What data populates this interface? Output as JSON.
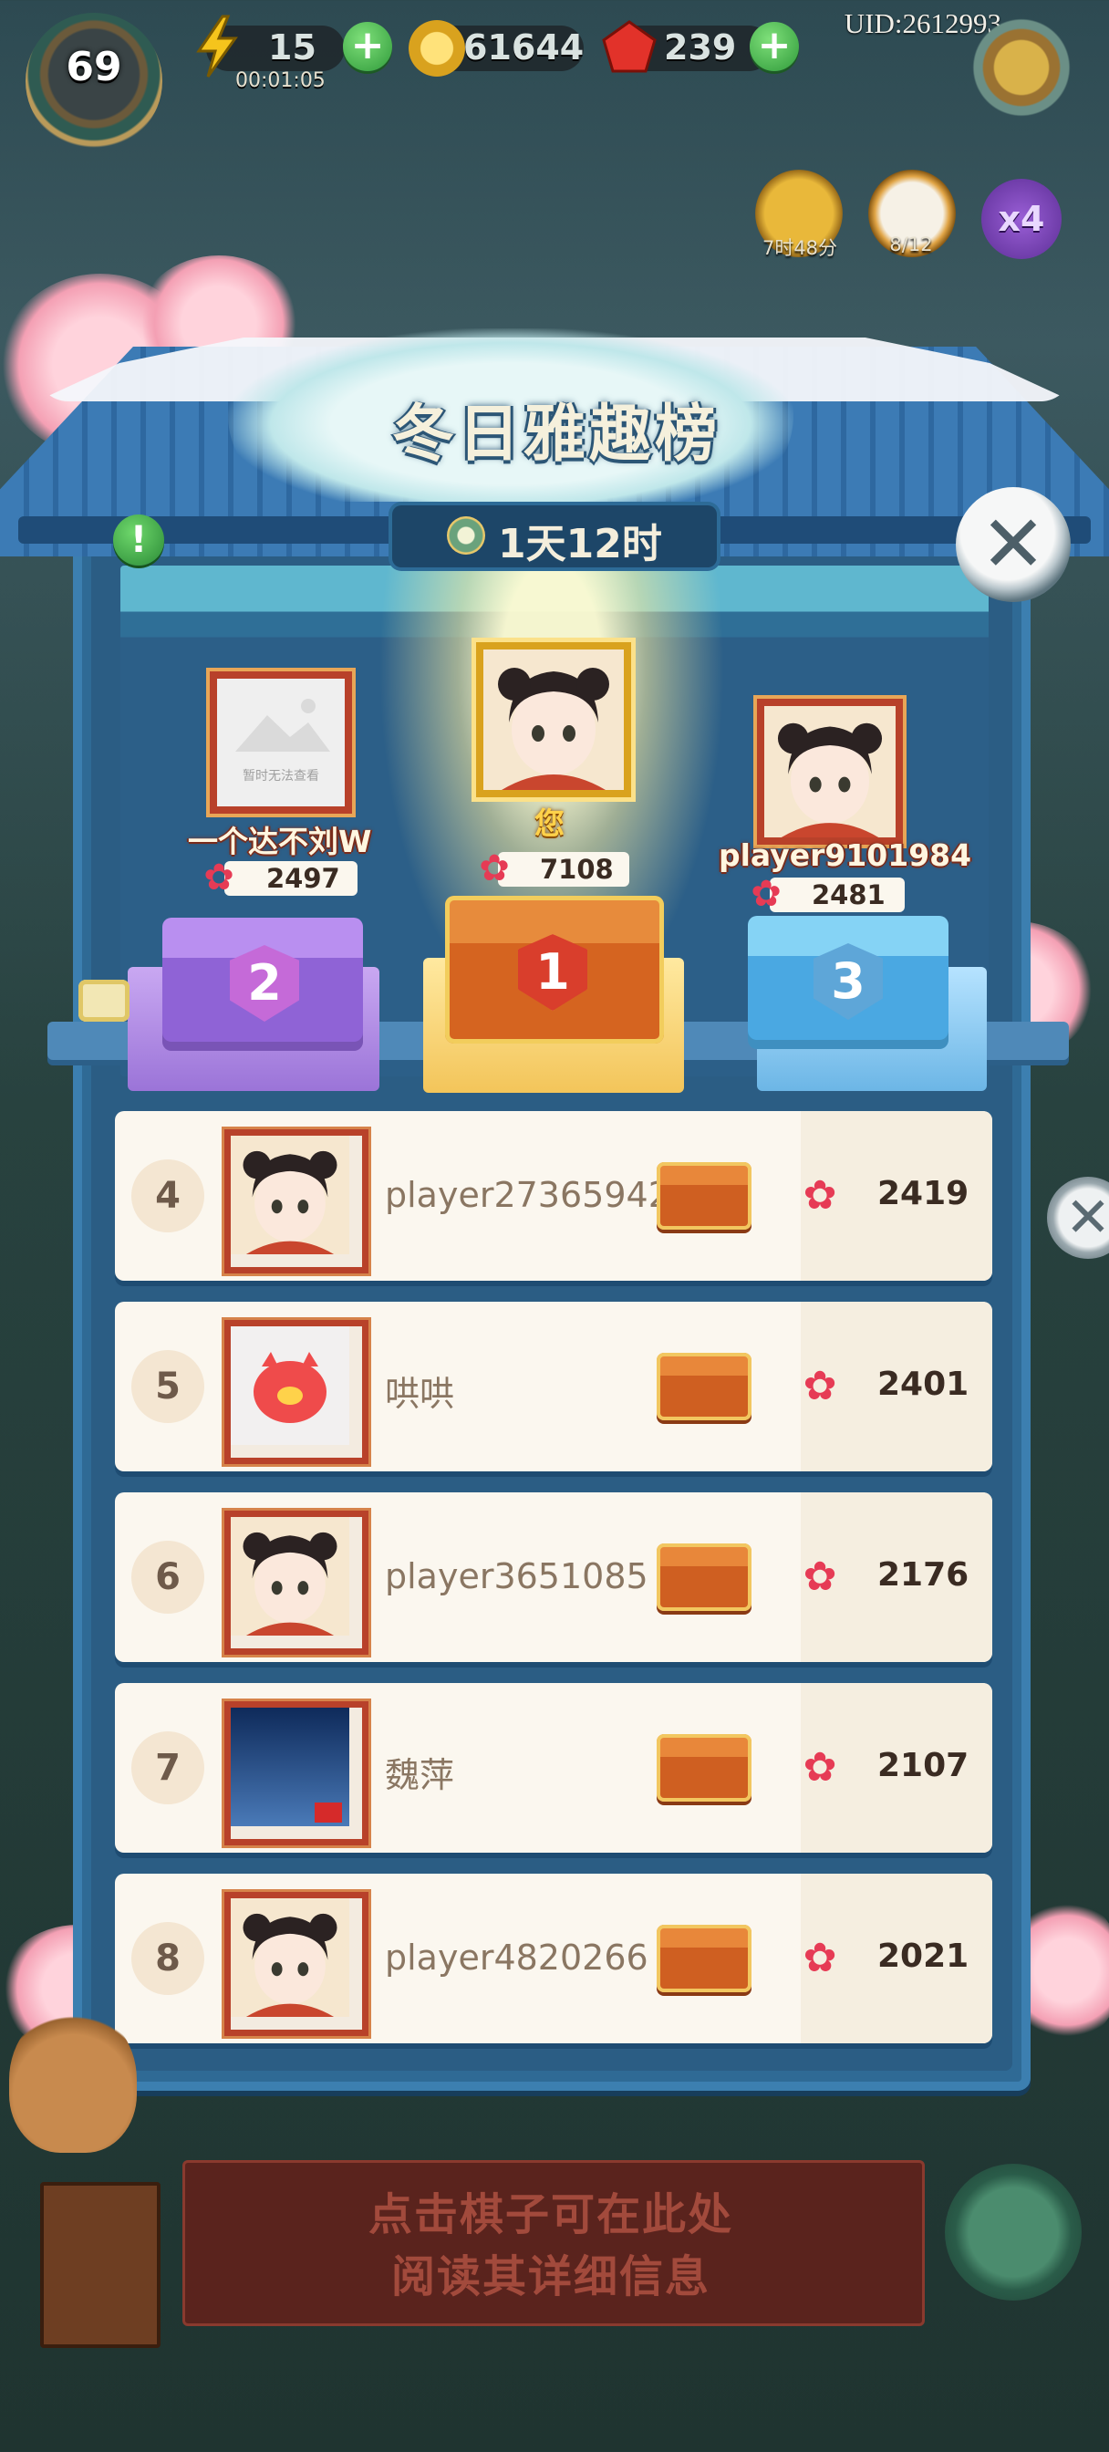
{
  "hud": {
    "level": "69",
    "energy": "15",
    "energy_timer": "00:01:05",
    "coins": "61644",
    "gems": "239",
    "uid": "UID:2612993",
    "side_timer": "7时48分",
    "side_count": "8/12",
    "multiplier": "x4",
    "badge_count": "12"
  },
  "panel": {
    "title": "冬日雅趣榜",
    "countdown": "1天12时",
    "info_icon": "!"
  },
  "podium": [
    {
      "rank": "2",
      "name": "一个达不刘W",
      "score": "2497",
      "avatar_note": "暂时无法查看"
    },
    {
      "rank": "1",
      "name": "您",
      "score": "7108"
    },
    {
      "rank": "3",
      "name": "player9101984",
      "score": "2481"
    }
  ],
  "rows": [
    {
      "rank": "4",
      "name": "player27365942",
      "score": "2419"
    },
    {
      "rank": "5",
      "name": "哄哄",
      "score": "2401"
    },
    {
      "rank": "6",
      "name": "player3651085",
      "score": "2176"
    },
    {
      "rank": "7",
      "name": "魏萍",
      "score": "2107"
    },
    {
      "rank": "8",
      "name": "player4820266",
      "score": "2021"
    }
  ],
  "hint": {
    "line1": "点击棋子可在此处",
    "line2": "阅读其详细信息"
  },
  "colors": {
    "frame": "#2f6a95",
    "row_bg": "#fbf7ef",
    "avatar_border": "#b8412a",
    "flower": "#e63b55",
    "plus_green": "#2f9a3a"
  }
}
